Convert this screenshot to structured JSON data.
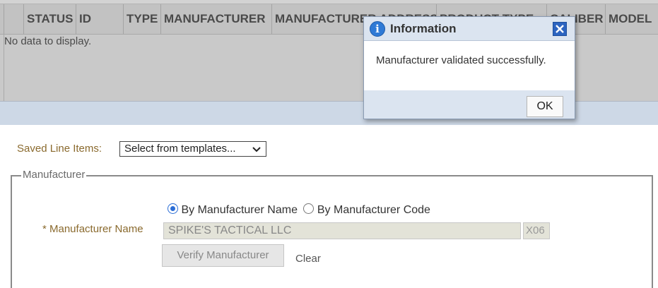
{
  "grid": {
    "columns": [
      "STATUS",
      "ID",
      "TYPE",
      "MANUFACTURER",
      "MANUFACTURER ADDRESS",
      "PRODUCT TYPE",
      "CALIBER",
      "MODEL"
    ],
    "empty_text": "No data to display."
  },
  "form": {
    "saved_label": "Saved Line Items:",
    "saved_select_value": "Select from templates...",
    "manufacturer_legend": "Manufacturer",
    "radio_by_name": "By Manufacturer Name",
    "radio_by_code": "By Manufacturer Code",
    "radio_selected": "By Manufacturer Name",
    "name_label": "* Manufacturer Name",
    "name_value": "SPIKE'S TACTICAL LLC",
    "code_value": "X06",
    "verify_label": "Verify Manufacturer",
    "clear_label": "Clear"
  },
  "dialog": {
    "title": "Information",
    "message": "Manufacturer validated successfully.",
    "ok_label": "OK",
    "icon": "info-icon",
    "close_icon": "close-icon"
  },
  "colors": {
    "overlay_gray": "#c9c9c9",
    "dialog_header": "#dbe4f0",
    "label_brown": "#8a6a2e",
    "radio_blue": "#2a6dd6"
  }
}
